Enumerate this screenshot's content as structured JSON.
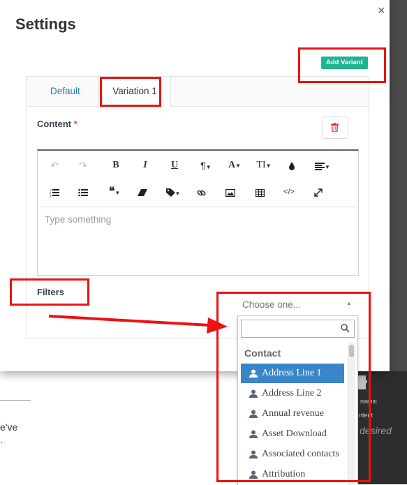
{
  "modal": {
    "title": "Settings",
    "close": "×",
    "add_variant": "Add Variant"
  },
  "tabs": [
    {
      "label": "Default"
    },
    {
      "label": "Variation 1"
    }
  ],
  "content": {
    "label": "Content",
    "required_mark": "*"
  },
  "editor": {
    "placeholder": "Type something",
    "toolbar_icons": [
      "undo-icon",
      "redo-icon",
      "bold-icon",
      "italic-icon",
      "underline-icon",
      "paragraph-icon",
      "font-color-icon",
      "font-size-icon",
      "color-drop-icon",
      "align-icon",
      "ordered-list-icon",
      "unordered-list-icon",
      "quote-icon",
      "eraser-icon",
      "tag-icon",
      "link-icon",
      "image-icon",
      "table-icon",
      "code-icon",
      "fullscreen-icon"
    ],
    "toolbar_glyphs": {
      "bold": "B",
      "italic": "I",
      "underline": "U",
      "paragraph": "¶",
      "font": "A",
      "font_size": "TI",
      "code": "</>"
    }
  },
  "filters": {
    "label": "Filters",
    "select_placeholder": "Choose one...",
    "group": "Contact",
    "options": [
      {
        "label": "Address Line 1",
        "selected": true
      },
      {
        "label": "Address Line 2",
        "selected": false
      },
      {
        "label": "Annual revenue",
        "selected": false
      },
      {
        "label": "Asset Download",
        "selected": false
      },
      {
        "label": "Associated contacts",
        "selected": false
      },
      {
        "label": "Attribution",
        "selected": false
      }
    ]
  },
  "background": {
    "fragment_1": "e've",
    "fragment_2": ".",
    "dark_text_1": "namic",
    "dark_text_2": "ntent",
    "desired": "desired"
  },
  "colors": {
    "accent_green": "#20b491",
    "selection_blue": "#3a85c8",
    "annotation_red": "#ee1111",
    "required_red": "#e0433b",
    "link_blue": "#2a7ab8"
  }
}
